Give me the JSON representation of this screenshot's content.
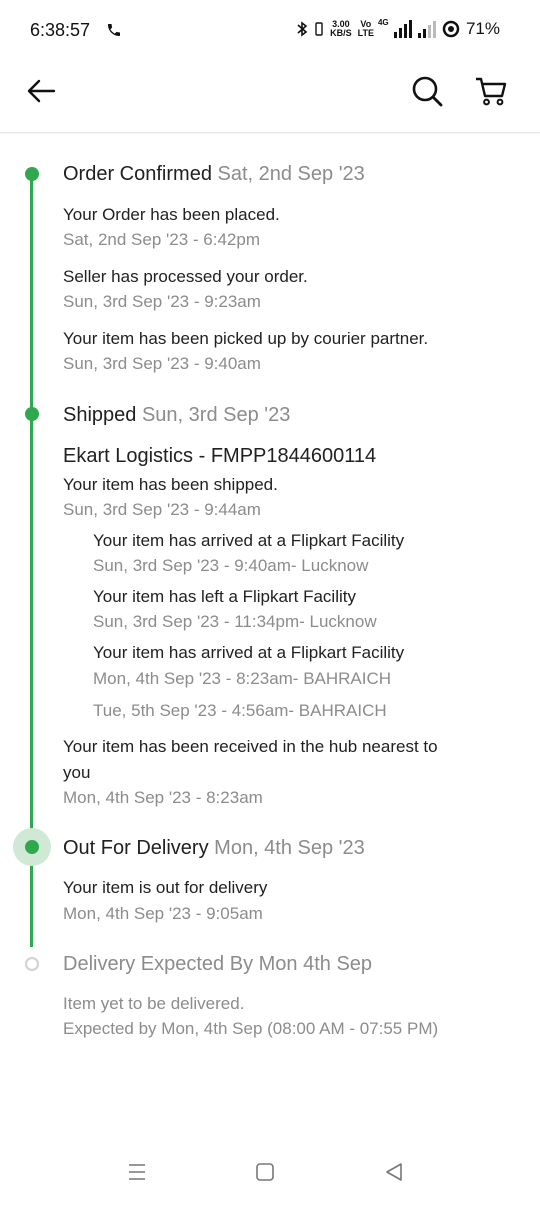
{
  "status_bar": {
    "time": "6:38:57",
    "speed_value": "3.00",
    "speed_unit": "KB/S",
    "volte_top": "Vo",
    "volte_bottom": "LTE",
    "network": "4G",
    "battery": "71%"
  },
  "app_bar": {
    "icons": [
      "back-arrow-icon",
      "search-icon",
      "cart-icon"
    ]
  },
  "colors": {
    "accent": "#2fa84f",
    "text": "#212121",
    "muted": "#8c8c8c",
    "pending": "#d0d0d0"
  },
  "timeline": {
    "order_confirmed": {
      "title": "Order Confirmed",
      "date": "Sat, 2nd Sep '23",
      "events": [
        {
          "text": "Your Order has been placed.",
          "time": "Sat, 2nd Sep '23 - 6:42pm"
        },
        {
          "text": "Seller has processed your order.",
          "time": "Sun, 3rd Sep '23 - 9:23am"
        },
        {
          "text": "Your item has been picked up by courier partner.",
          "time": "Sun, 3rd Sep '23 - 9:40am"
        }
      ]
    },
    "shipped": {
      "title": "Shipped",
      "date": "Sun, 3rd Sep '23",
      "courier": "Ekart Logistics - FMPP1844600114",
      "event_text": "Your item has been shipped.",
      "event_time": "Sun, 3rd Sep '23 - 9:44am",
      "sub_events": [
        {
          "text": "Your item has arrived at a Flipkart Facility",
          "time": "Sun, 3rd Sep '23 - 9:40am- Lucknow"
        },
        {
          "text": "Your item has left a Flipkart Facility",
          "time": "Sun, 3rd Sep '23 - 11:34pm- Lucknow"
        },
        {
          "text": "Your item has arrived at a Flipkart Facility",
          "time": "Mon, 4th Sep '23 - 8:23am- BAHRAICH"
        },
        {
          "time": "Tue, 5th Sep '23 - 4:56am- BAHRAICH"
        }
      ],
      "hub_text_line1": "Your item has been received in the hub nearest to",
      "hub_text_line2": "you",
      "hub_time": "Mon, 4th Sep '23 - 8:23am"
    },
    "out_for_delivery": {
      "title": "Out For Delivery",
      "date": "Mon, 4th Sep '23",
      "event_text": "Your item is out for delivery",
      "event_time": "Mon, 4th Sep '23 - 9:05am"
    },
    "delivery_expected": {
      "title": "Delivery Expected By Mon 4th Sep",
      "note1": "Item yet to be delivered.",
      "note2": "Expected by Mon, 4th Sep (08:00 AM - 07:55 PM)"
    }
  },
  "nav_bar": {
    "icons": [
      "recents-icon",
      "home-icon",
      "back-icon"
    ]
  }
}
